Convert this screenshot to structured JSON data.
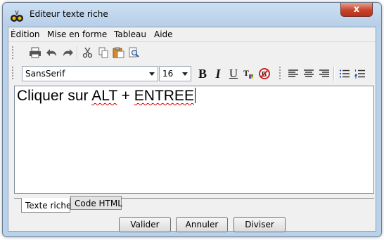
{
  "window": {
    "title": "Editeur texte riche",
    "close_glyph": "x"
  },
  "menubar": {
    "items": [
      "Édition",
      "Mise en forme",
      "Tableau",
      "Aide"
    ]
  },
  "toolbar1": {
    "icons": [
      "print-icon",
      "undo-icon",
      "redo-icon",
      "cut-icon",
      "copy-icon",
      "paste-icon",
      "print-preview-icon"
    ]
  },
  "toolbar2": {
    "font_family": "SansSerif",
    "font_size": "16",
    "bold_glyph": "B",
    "italic_glyph": "I",
    "underline_glyph": "U",
    "icons": [
      "bold-icon",
      "italic-icon",
      "underline-icon",
      "font-color-icon",
      "clear-format-icon",
      "align-left-icon",
      "align-center-icon",
      "align-right-icon",
      "bulleted-list-icon",
      "numbered-list-icon"
    ]
  },
  "editor": {
    "word1": "Cliquer sur",
    "word2": "ALT",
    "word3": "+",
    "word4": "ENTREE"
  },
  "tabs": [
    {
      "label": "Texte riche"
    },
    {
      "label": "Code HTML"
    }
  ],
  "buttons": {
    "validate": "Valider",
    "cancel": "Annuler",
    "split": "Diviser"
  },
  "colors": {
    "title_bar": "#b7cee7",
    "close_button": "#c6452d",
    "spellcheck": "#e00000"
  }
}
